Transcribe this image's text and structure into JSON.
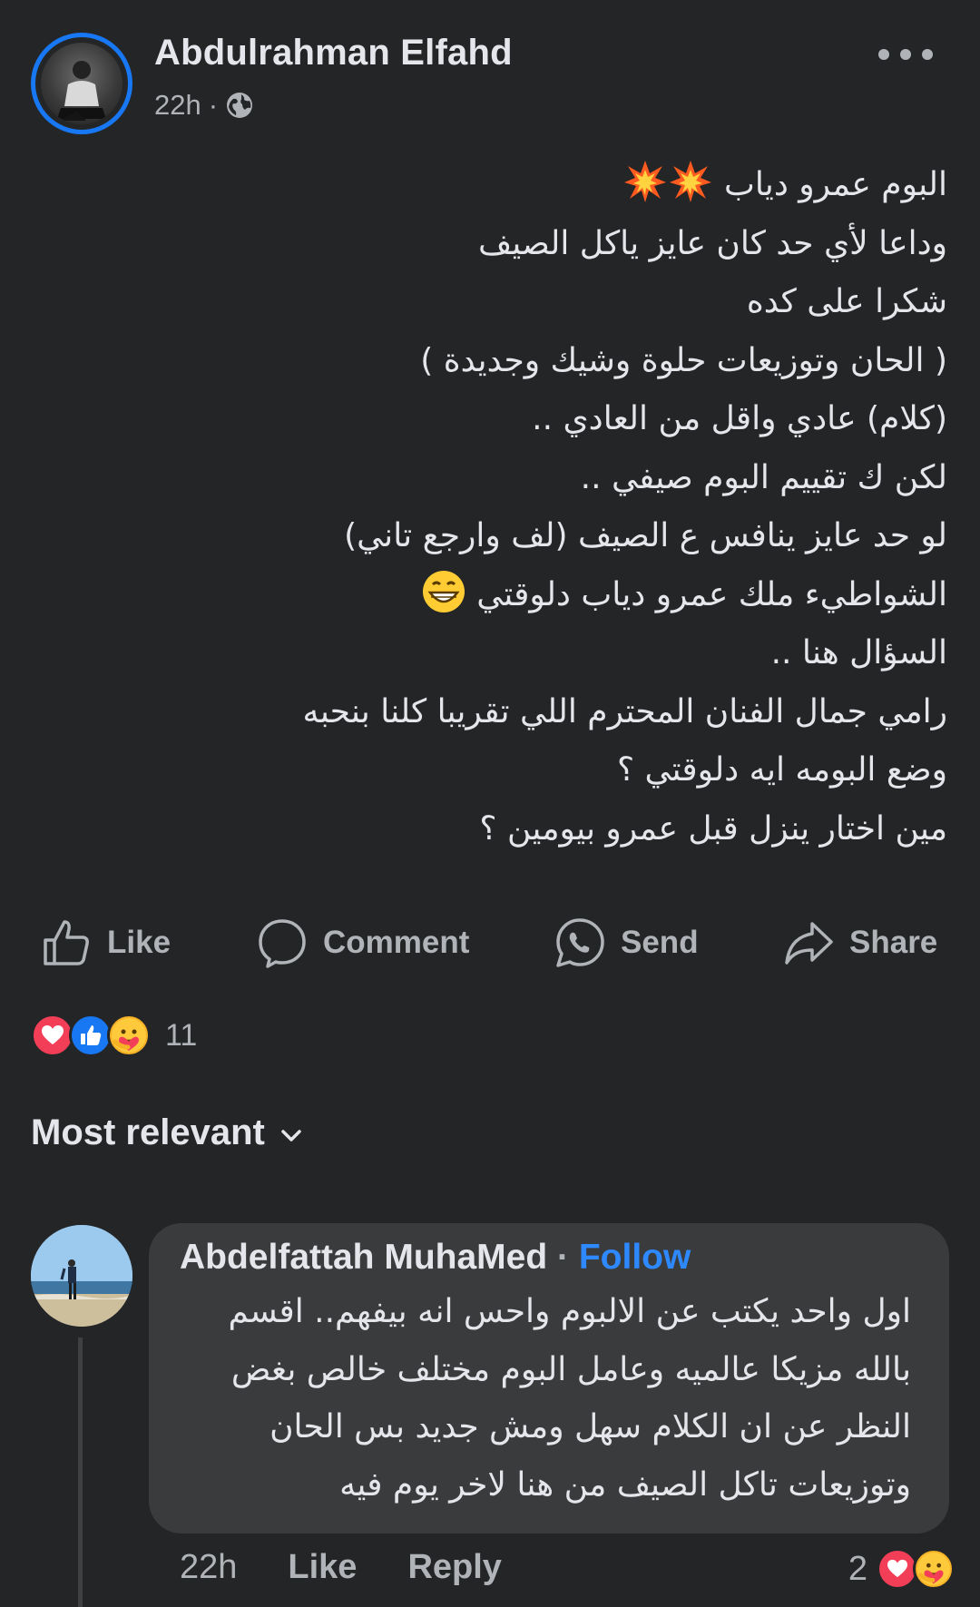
{
  "post": {
    "author": "Abdulrahman Elfahd",
    "time": "22h",
    "separator": "·",
    "privacy_icon": "globe-icon",
    "lines": [
      "البوم عمرو دياب",
      "وداعا لأي حد كان عايز ياكل الصيف",
      "شكرا على كده",
      "( الحان وتوزيعات حلوة وشيك وجديدة )",
      "(كلام) عادي واقل من العادي ..",
      "لكن ك تقييم البوم صيفي ..",
      "لو حد عايز ينافس ع الصيف (لف وارجع تاني)",
      "الشواطيء ملك عمرو دياب دلوقتي",
      "السؤال هنا ..",
      "رامي جمال الفنان المحترم اللي تقريبا كلنا بنحبه",
      "وضع البومه ايه دلوقتي ؟",
      "مين اختار ينزل قبل عمرو بيومين ؟"
    ]
  },
  "actions": {
    "like": "Like",
    "comment": "Comment",
    "send": "Send",
    "share": "Share"
  },
  "reactions": {
    "count": "11",
    "types": [
      "love",
      "like",
      "care"
    ]
  },
  "sort": {
    "label": "Most relevant"
  },
  "comment": {
    "author": "Abdelfattah MuhaMed",
    "separator": "·",
    "follow": "Follow",
    "lines": [
      "اول واحد يكتب عن الالبوم واحس انه بيفهم.. اقسم",
      "بالله مزيكا عالميه وعامل البوم مختلف خالص بغض",
      "النظر عن ان الكلام سهل ومش جديد بس الحان",
      "وتوزيعات تاكل الصيف من هنا لاخر يوم فيه"
    ],
    "time": "22h",
    "like": "Like",
    "reply": "Reply",
    "reaction_count": "2"
  },
  "colors": {
    "background": "#242526",
    "bubble": "#3a3b3c",
    "accent": "#1877f2",
    "follow": "#2e89ff",
    "secondary_text": "#b0b3b8"
  }
}
